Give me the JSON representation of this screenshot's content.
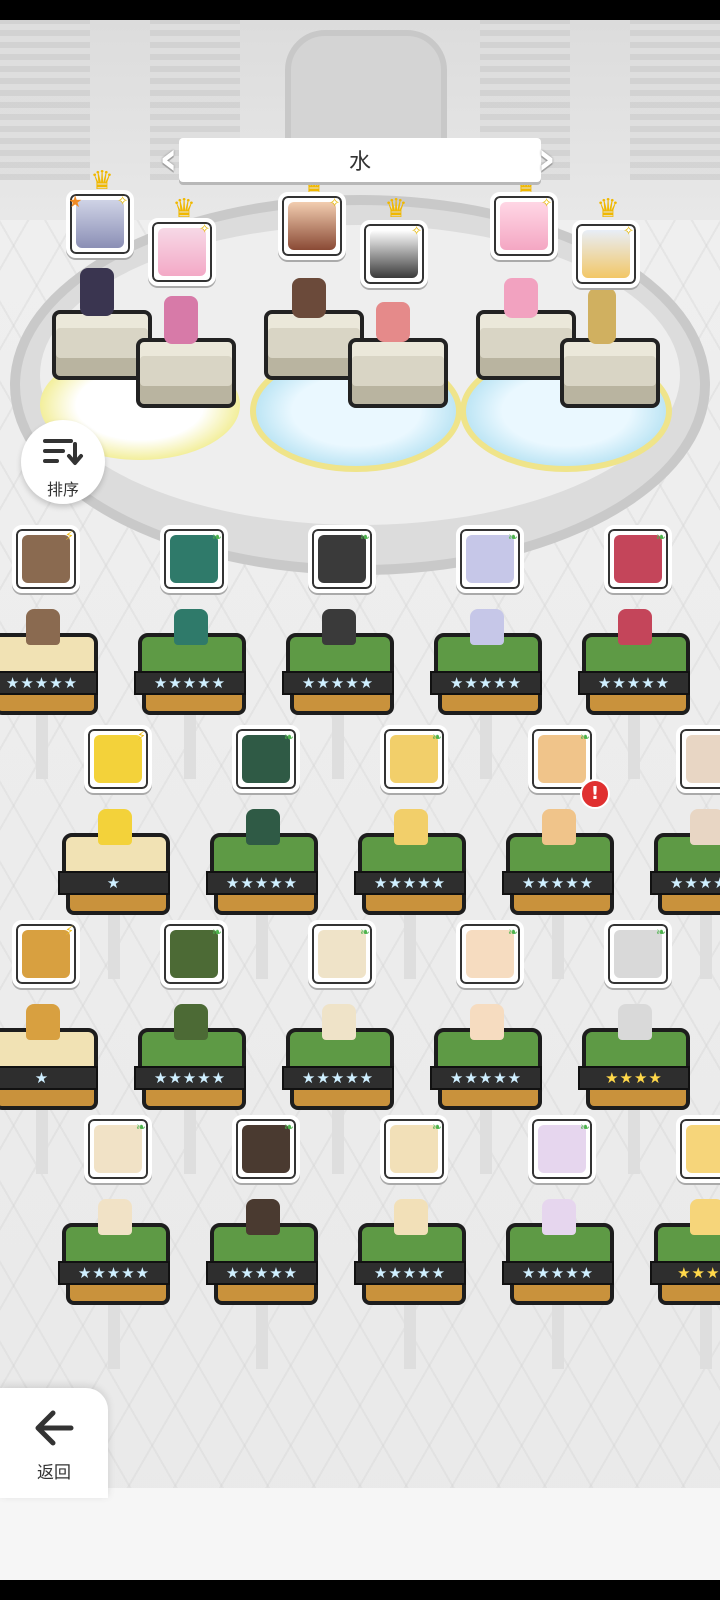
{
  "header": {
    "title": "水"
  },
  "buttons": {
    "sort_label": "排序",
    "back_label": "返回"
  },
  "icons": {
    "left_arrow": "chevron-left-icon",
    "right_arrow": "chevron-right-icon",
    "sort": "sort-icon",
    "back": "back-arrow-icon",
    "element_wind": "leaf-icon",
    "element_thunder": "bolt-icon",
    "alert": "exclamation-icon"
  },
  "team": [
    {
      "slot": 1,
      "crowned": true,
      "badge": "★"
    },
    {
      "slot": 2,
      "crowned": true
    },
    {
      "slot": 3,
      "crowned": true
    },
    {
      "slot": 4,
      "crowned": true
    },
    {
      "slot": 5,
      "crowned": true
    },
    {
      "slot": 6,
      "crowned": true
    }
  ],
  "roster": {
    "rows": [
      {
        "units": [
          {
            "element": "thunder",
            "stars": "★★★★★",
            "partial": true
          },
          {
            "element": "wind",
            "stars": "★★★★★"
          },
          {
            "element": "wind",
            "stars": "★★★★★"
          },
          {
            "element": "wind",
            "stars": "★★★★★"
          },
          {
            "element": "wind",
            "stars": "★★★★★"
          }
        ]
      },
      {
        "units": [
          {
            "element": "thunder",
            "stars": "★"
          },
          {
            "element": "wind",
            "stars": "★★★★★"
          },
          {
            "element": "wind",
            "stars": "★★★★★"
          },
          {
            "element": "wind",
            "stars": "★★★★★",
            "alert": "!"
          },
          {
            "element": "wind",
            "stars": "★★★★★"
          }
        ]
      },
      {
        "units": [
          {
            "element": "thunder",
            "stars": "★",
            "partial": true
          },
          {
            "element": "wind",
            "stars": "★★★★★"
          },
          {
            "element": "wind",
            "stars": "★★★★★"
          },
          {
            "element": "wind",
            "stars": "★★★★★"
          },
          {
            "element": "wind",
            "stars": "★★★★"
          }
        ]
      },
      {
        "units": [
          {
            "element": "wind",
            "stars": "★★★★★"
          },
          {
            "element": "wind",
            "stars": "★★★★★"
          },
          {
            "element": "wind",
            "stars": "★★★★★"
          },
          {
            "element": "wind",
            "stars": "★★★★★"
          },
          {
            "element": "wind",
            "stars": "★★★★"
          }
        ]
      }
    ]
  },
  "colors": {
    "grass": "#5e9a45",
    "band": "#2e2e2e",
    "base": "#c9923c",
    "star_blue": "#cfefff",
    "star_gold": "#ffd84a",
    "alert": "#e03030"
  }
}
